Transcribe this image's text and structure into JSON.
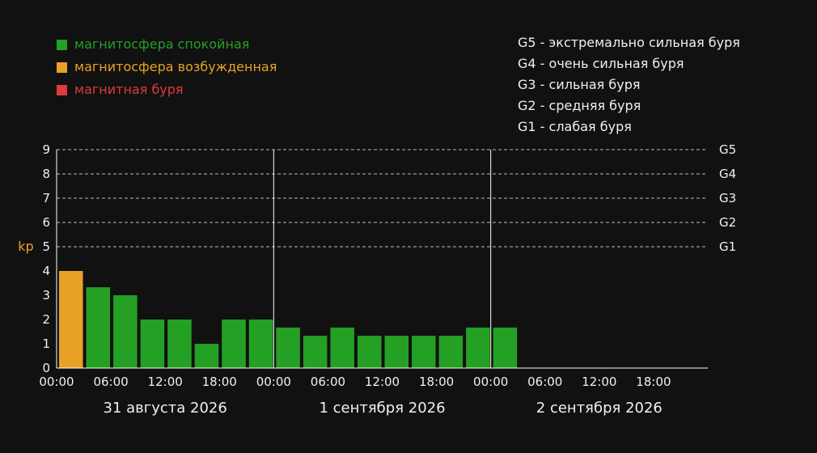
{
  "colors": {
    "background": "#111111",
    "text": "#f0f0f0",
    "axis": "#ffffff",
    "grid": "#bbbbbb",
    "quiet": "#24a024",
    "excited": "#e8a227",
    "storm": "#e03a3a",
    "ylabel": "#e8a227"
  },
  "legend": [
    {
      "label": "магнитосфера спокойная",
      "color": "#24a024"
    },
    {
      "label": "магнитосфера возбужденная",
      "color": "#e8a227"
    },
    {
      "label": "магнитная буря",
      "color": "#e03a3a"
    }
  ],
  "storm_scale": [
    "G5 - экстремально сильная буря",
    "G4 - очень сильная буря",
    "G3 - сильная буря",
    "G2 - средняя буря",
    "G1 - слабая буря"
  ],
  "chart_data": {
    "type": "bar",
    "ylabel": "kp",
    "ylim": [
      0,
      9
    ],
    "yticks": [
      0,
      1,
      2,
      3,
      4,
      5,
      6,
      7,
      8,
      9
    ],
    "grid": "dashed horizontal at 5-9",
    "right_levels": [
      {
        "value": 9,
        "label": "G5"
      },
      {
        "value": 8,
        "label": "G4"
      },
      {
        "value": 7,
        "label": "G3"
      },
      {
        "value": 6,
        "label": "G2"
      },
      {
        "value": 5,
        "label": "G1"
      }
    ],
    "x_tick_labels": [
      "00:00",
      "06:00",
      "12:00",
      "18:00",
      "00:00",
      "06:00",
      "12:00",
      "18:00",
      "00:00",
      "06:00",
      "12:00",
      "18:00"
    ],
    "days": [
      "31 августа 2026",
      "1 сентября 2026",
      "2 сентября 2026"
    ],
    "slots_total": 24,
    "values": [
      4,
      3.33,
      3,
      2,
      2,
      1,
      2,
      2,
      1.67,
      1.33,
      1.67,
      1.33,
      1.33,
      1.33,
      1.33,
      1.67,
      1.67
    ],
    "colors": [
      "#e8a227",
      "#24a024",
      "#24a024",
      "#24a024",
      "#24a024",
      "#24a024",
      "#24a024",
      "#24a024",
      "#24a024",
      "#24a024",
      "#24a024",
      "#24a024",
      "#24a024",
      "#24a024",
      "#24a024",
      "#24a024",
      "#24a024"
    ]
  }
}
